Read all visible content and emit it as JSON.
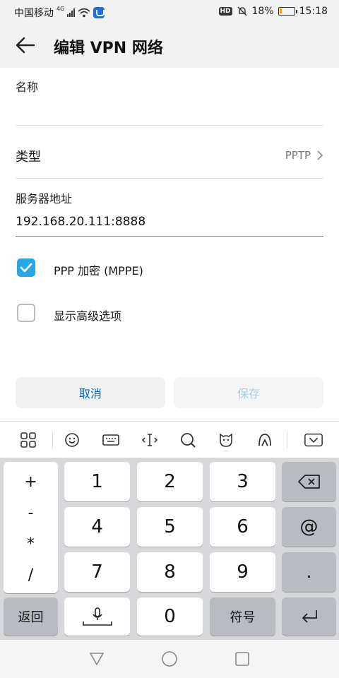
{
  "status": {
    "carrier": "中国移动",
    "net": "4G",
    "battery": "18%",
    "battery_level": 0.18,
    "time": "15:18",
    "hd": "HD"
  },
  "header": {
    "title": "编辑 VPN 网络"
  },
  "form": {
    "name_label": "名称",
    "name_value": "",
    "type_label": "类型",
    "type_value": "PPTP",
    "server_label": "服务器地址",
    "server_value": "192.168.20.111:8888",
    "ppp_label": "PPP 加密 (MPPE)",
    "ppp_checked": true,
    "advanced_label": "显示高级选项",
    "advanced_checked": false
  },
  "buttons": {
    "cancel": "取消",
    "save": "保存"
  },
  "keyboard": {
    "symbols": [
      "+",
      "-",
      "*",
      "/"
    ],
    "digits": [
      "1",
      "2",
      "3",
      "4",
      "5",
      "6",
      "7",
      "8",
      "9",
      "0"
    ],
    "at": "@",
    "dot": ".",
    "back_label": "返回",
    "symbol_label": "符号"
  },
  "colors": {
    "accent": "#2aa6e8",
    "cancel_text": "#0a6aa8"
  }
}
